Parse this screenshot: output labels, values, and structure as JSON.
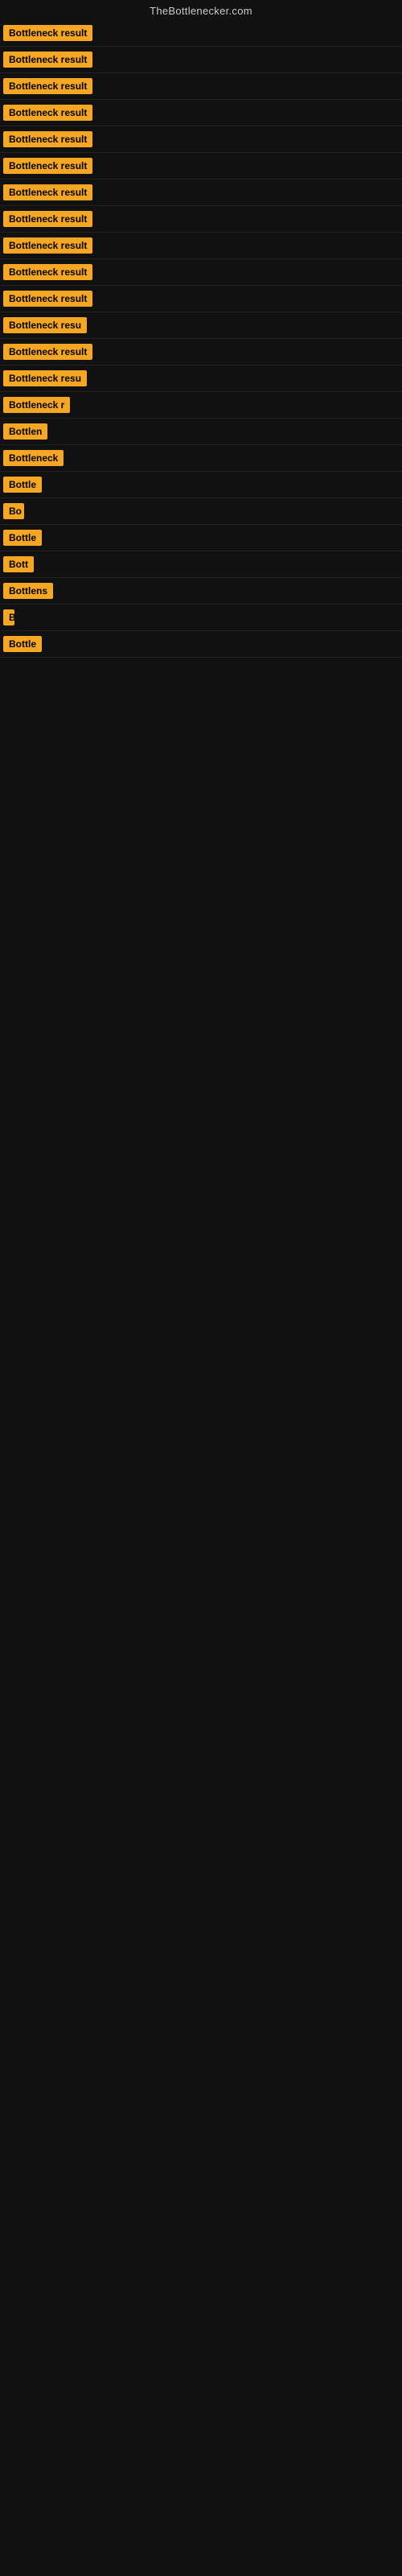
{
  "site": {
    "title": "TheBottlenecker.com"
  },
  "rows": [
    {
      "id": 1,
      "label": "Bottleneck result",
      "width": 130
    },
    {
      "id": 2,
      "label": "Bottleneck result",
      "width": 130
    },
    {
      "id": 3,
      "label": "Bottleneck result",
      "width": 130
    },
    {
      "id": 4,
      "label": "Bottleneck result",
      "width": 130
    },
    {
      "id": 5,
      "label": "Bottleneck result",
      "width": 130
    },
    {
      "id": 6,
      "label": "Bottleneck result",
      "width": 130
    },
    {
      "id": 7,
      "label": "Bottleneck result",
      "width": 130
    },
    {
      "id": 8,
      "label": "Bottleneck result",
      "width": 130
    },
    {
      "id": 9,
      "label": "Bottleneck result",
      "width": 130
    },
    {
      "id": 10,
      "label": "Bottleneck result",
      "width": 130
    },
    {
      "id": 11,
      "label": "Bottleneck result",
      "width": 130
    },
    {
      "id": 12,
      "label": "Bottleneck resu",
      "width": 110
    },
    {
      "id": 13,
      "label": "Bottleneck result",
      "width": 120
    },
    {
      "id": 14,
      "label": "Bottleneck resu",
      "width": 108
    },
    {
      "id": 15,
      "label": "Bottleneck r",
      "width": 88
    },
    {
      "id": 16,
      "label": "Bottlen",
      "width": 62
    },
    {
      "id": 17,
      "label": "Bottleneck",
      "width": 76
    },
    {
      "id": 18,
      "label": "Bottle",
      "width": 54
    },
    {
      "id": 19,
      "label": "Bo",
      "width": 26
    },
    {
      "id": 20,
      "label": "Bottle",
      "width": 54
    },
    {
      "id": 21,
      "label": "Bott",
      "width": 38
    },
    {
      "id": 22,
      "label": "Bottlens",
      "width": 66
    },
    {
      "id": 23,
      "label": "B",
      "width": 14
    },
    {
      "id": 24,
      "label": "Bottle",
      "width": 54
    }
  ]
}
